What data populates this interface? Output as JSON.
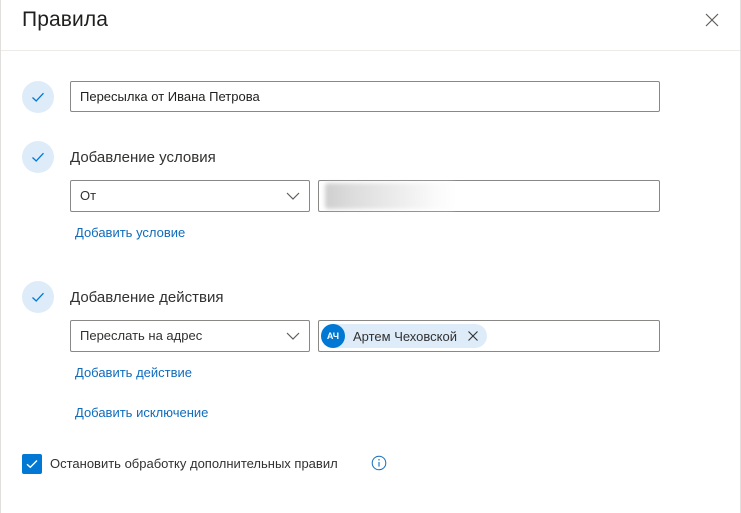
{
  "dialog": {
    "title": "Правила"
  },
  "rule_name": {
    "value": "Пересылка от Ивана Петрова"
  },
  "condition": {
    "heading": "Добавление условия",
    "selected": "От",
    "add_link": "Добавить условие"
  },
  "action": {
    "heading": "Добавление действия",
    "selected": "Переслать на адрес",
    "recipient": {
      "initials": "АЧ",
      "name": "Артем Чеховской"
    },
    "add_link": "Добавить действие",
    "add_exception_link": "Добавить исключение"
  },
  "stop_processing": {
    "checked": true,
    "label": "Остановить обработку дополнительных правил"
  },
  "colors": {
    "accent": "#0078d4",
    "link": "#0f6cbd",
    "step_circle": "#deecf9"
  },
  "icons": {
    "close": "close-icon",
    "step_done": "checkmark-icon",
    "dropdown": "chevron-down-icon",
    "remove": "dismiss-icon",
    "info": "info-icon"
  }
}
